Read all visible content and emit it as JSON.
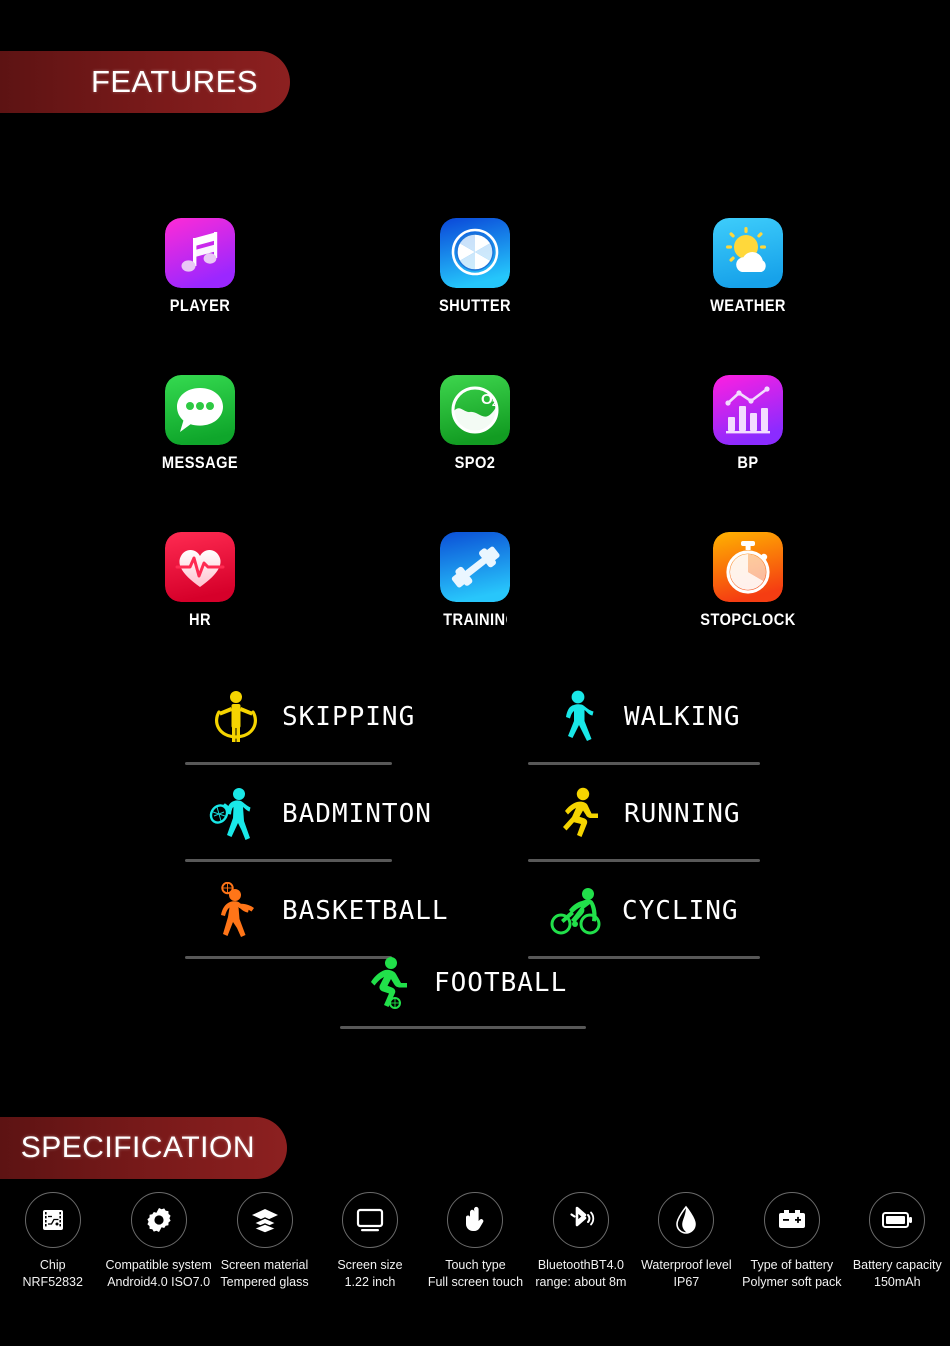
{
  "banners": {
    "features": "FEATURES",
    "specification": "SPECIFICATION"
  },
  "colors": {
    "banner_dark": "#5d1313",
    "banner_light": "#8c2020",
    "background": "#000000",
    "divider": "#585858",
    "label_text": "#ffffff"
  },
  "apps": {
    "rows": [
      [
        {
          "label": "PLAYER",
          "icon": "music-note-icon",
          "tile_from": "#ff2bd6",
          "tile_to": "#9b27ff"
        },
        {
          "label": "SHUTTER",
          "icon": "camera-shutter-icon",
          "tile_from": "#0a46d8",
          "tile_to": "#25c6fb"
        },
        {
          "label": "WEATHER",
          "icon": "sun-cloud-icon",
          "tile_from": "#2ec2fb",
          "tile_to": "#1aa7f0"
        }
      ],
      [
        {
          "label": "MESSAGE",
          "icon": "chat-bubble-icon",
          "tile_from": "#2fd44a",
          "tile_to": "#0fa62b"
        },
        {
          "label": "SPO2",
          "icon": "oxygen-drop-icon",
          "tile_from": "#3ad64c",
          "tile_to": "#129c22"
        },
        {
          "label": "BP",
          "icon": "bar-chart-icon",
          "tile_from": "#ff1fe0",
          "tile_to": "#8b2bff"
        }
      ],
      [
        {
          "label": "HR",
          "icon": "heart-pulse-icon",
          "tile_from": "#ff2b4a",
          "tile_to": "#d6002a"
        },
        {
          "label": "TRAINING",
          "icon": "dumbbell-icon",
          "tile_from": "#0b4fd6",
          "tile_to": "#28c6fb"
        },
        {
          "label": "STOPCLOCK",
          "icon": "stopwatch-icon",
          "tile_from": "#ffb300",
          "tile_to": "#f53d12"
        }
      ]
    ]
  },
  "sports": [
    {
      "label": "SKIPPING",
      "icon": "skipping-rope-icon",
      "color": "#f5d400"
    },
    {
      "label": "WALKING",
      "icon": "walking-person-icon",
      "color": "#19e8e8"
    },
    {
      "label": "BADMINTON",
      "icon": "badminton-icon",
      "color": "#19e8e8"
    },
    {
      "label": "RUNNING",
      "icon": "running-person-icon",
      "color": "#f5d400"
    },
    {
      "label": "BASKETBALL",
      "icon": "basketball-icon",
      "color": "#ff7518"
    },
    {
      "label": "CYCLING",
      "icon": "cycling-icon",
      "color": "#21e04a"
    },
    {
      "label": "FOOTBALL",
      "icon": "football-icon",
      "color": "#21e04a"
    }
  ],
  "specs": [
    {
      "icon": "chip-icon",
      "line1": "Chip",
      "line2": "NRF52832"
    },
    {
      "icon": "gear-icon",
      "line1": "Compatible system",
      "line2": "Android4.0 ISO7.0"
    },
    {
      "icon": "layers-icon",
      "line1": "Screen material",
      "line2": "Tempered glass"
    },
    {
      "icon": "monitor-icon",
      "line1": "Screen size",
      "line2": "1.22 inch"
    },
    {
      "icon": "touch-hand-icon",
      "line1": "Touch type",
      "line2": "Full screen touch"
    },
    {
      "icon": "bluetooth-icon",
      "line1": "BluetoothBT4.0",
      "line2": "range: about 8m"
    },
    {
      "icon": "water-drop-icon",
      "line1": "Waterproof level",
      "line2": "IP67"
    },
    {
      "icon": "car-battery-icon",
      "line1": "Type of battery",
      "line2": "Polymer soft pack"
    },
    {
      "icon": "battery-icon",
      "line1": "Battery capacity",
      "line2": "150mAh"
    }
  ]
}
